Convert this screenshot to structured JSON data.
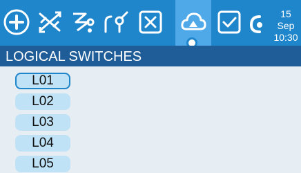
{
  "header": {
    "date": "15 Sep",
    "time": "10:30",
    "tabs": [
      {
        "icon": "add-icon"
      },
      {
        "icon": "cross-arrows-icon"
      },
      {
        "icon": "curve-icon"
      },
      {
        "icon": "switch-icon"
      },
      {
        "icon": "x-box-icon"
      },
      {
        "icon": "cloud-icon",
        "active": true
      },
      {
        "icon": "check-box-icon"
      },
      {
        "icon": "telemetry-icon"
      }
    ]
  },
  "section": {
    "title": "LOGICAL SWITCHES"
  },
  "switches": [
    {
      "label": "L01",
      "selected": true
    },
    {
      "label": "L02"
    },
    {
      "label": "L03"
    },
    {
      "label": "L04"
    },
    {
      "label": "L05"
    }
  ],
  "colors": {
    "topbar": "#1f86cc",
    "header_bar": "#1f5d99",
    "background": "#e7eef3",
    "item": "#bfe2f6"
  }
}
